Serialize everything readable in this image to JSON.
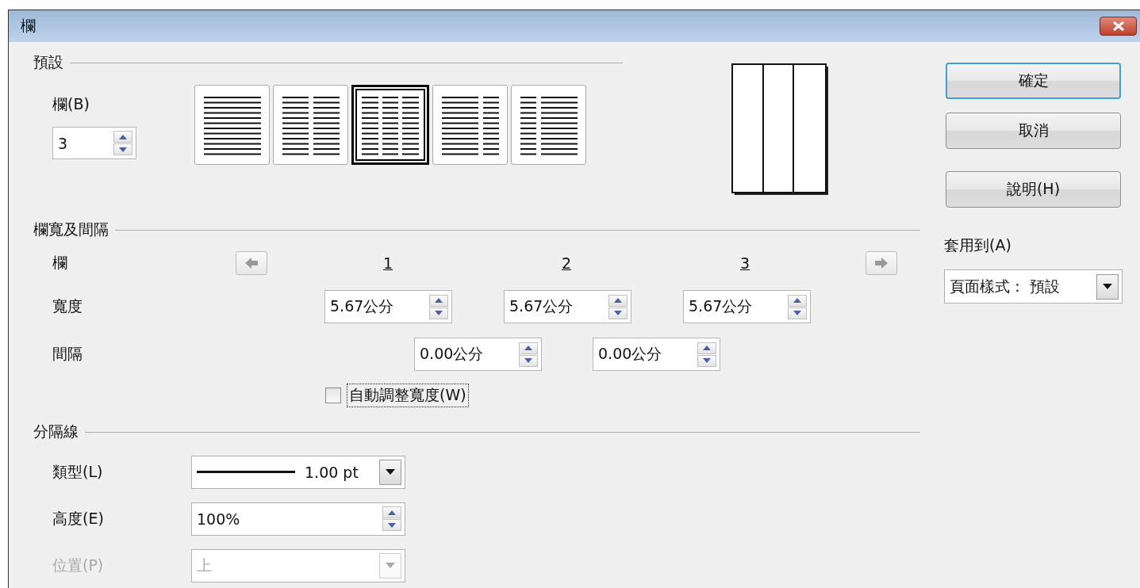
{
  "window": {
    "title": "欄"
  },
  "presets": {
    "heading": "預設",
    "columns_label": "欄(B)",
    "columns_value": "3",
    "layouts": [
      {
        "kind": "one",
        "selected": false
      },
      {
        "kind": "two",
        "selected": false
      },
      {
        "kind": "three",
        "selected": true
      },
      {
        "kind": "wide_left",
        "selected": false
      },
      {
        "kind": "wide_right",
        "selected": false
      }
    ]
  },
  "width_spacing": {
    "heading": "欄寬及間隔",
    "column_label": "欄",
    "width_label": "寬度",
    "spacing_label": "間隔",
    "column_numbers": [
      "1",
      "2",
      "3"
    ],
    "widths": [
      "5.67公分",
      "5.67公分",
      "5.67公分"
    ],
    "spacings": [
      "0.00公分",
      "0.00公分"
    ],
    "autofit": {
      "label": "自動調整寬度(W)",
      "checked": false,
      "focused": true
    }
  },
  "separator": {
    "heading": "分隔線",
    "fields": [
      {
        "kind": "line",
        "label": "類型(L)",
        "value": "1.00 pt",
        "disabled": false
      },
      {
        "kind": "spin",
        "label": "高度(E)",
        "value": "100%",
        "disabled": false
      },
      {
        "kind": "dropdown",
        "label": "位置(P)",
        "value": "上",
        "disabled": true
      }
    ]
  },
  "buttons": [
    {
      "label": "確定",
      "default": true
    },
    {
      "label": "取消",
      "default": false
    },
    {
      "label": "說明(H)",
      "default": false
    }
  ],
  "apply_to": {
    "label": "套用到(A)",
    "value": "頁面樣式： 預設"
  }
}
